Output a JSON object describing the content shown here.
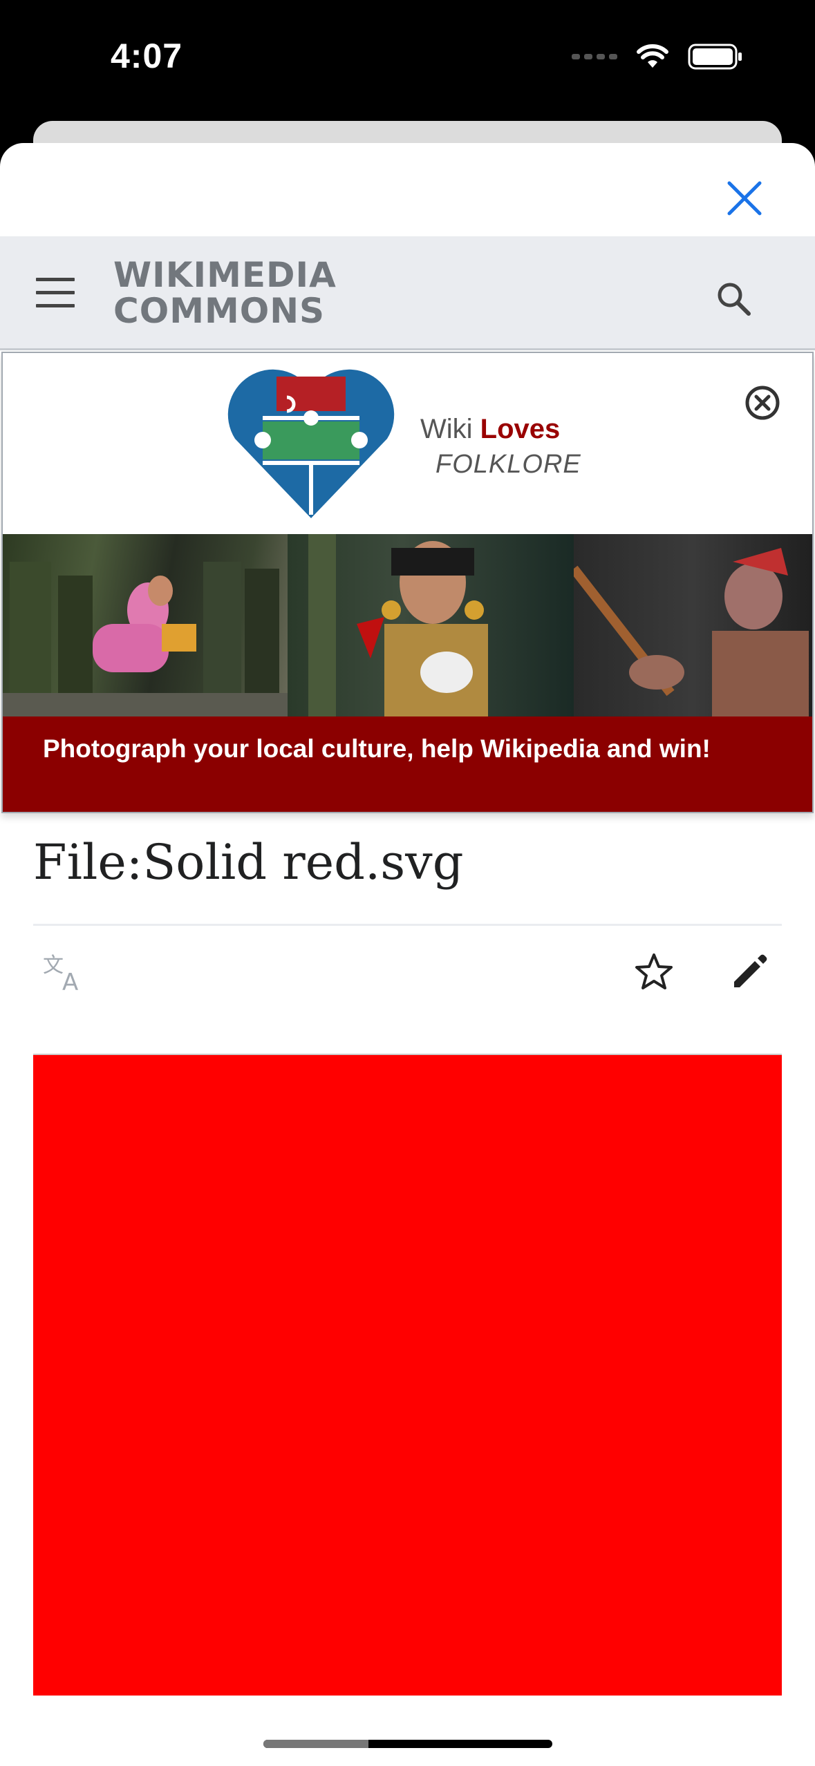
{
  "status_bar": {
    "time": "4:07"
  },
  "sheet": {
    "close_icon": "close-icon"
  },
  "wiki_header": {
    "logo_line1": "WIKIMEDIA",
    "logo_line2": "COMMONS",
    "menu_icon": "hamburger-icon",
    "search_icon": "search-icon"
  },
  "banner": {
    "logo_word1": "Wiki",
    "logo_word2": "Loves",
    "logo_word3": "FOLKLORE",
    "caption": "Photograph your local culture, help Wikipedia and win!",
    "caption_color": "#8b0000",
    "close_icon": "circle-close-icon"
  },
  "page": {
    "title": "File:Solid red.svg",
    "language_icon": "translate-icon",
    "watch_icon": "star-icon",
    "edit_icon": "pencil-icon",
    "image_color": "#ff0000"
  }
}
